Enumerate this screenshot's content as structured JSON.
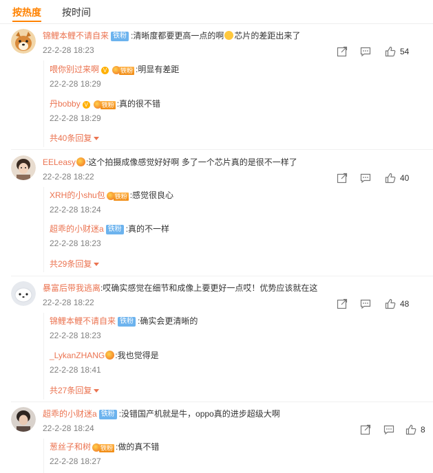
{
  "tabs": {
    "hot": "按热度",
    "time": "按时间"
  },
  "comments": [
    {
      "user": "锦鲤本鲤不请自来",
      "badge": "铁粉",
      "text": ":清晰度都要更高一点的啊",
      "text2": "芯片的差距出来了",
      "time": "22-2-28 18:23",
      "likes": "54",
      "replies": [
        {
          "user": "喂你别过来啊",
          "badge": "铁粉",
          "text": ":明显有差距",
          "time": "22-2-28 18:29"
        },
        {
          "user": "丹bobby",
          "badge": "铁粉",
          "text": ":真的很不错",
          "time": "22-2-28 18:29"
        }
      ],
      "more": "共40条回复"
    },
    {
      "user": "EELeasy",
      "text": ":这个拍摄成像感觉好好啊 多了一个芯片真的是很不一样了",
      "time": "22-2-28 18:22",
      "likes": "40",
      "replies": [
        {
          "user": "XRH的小shu包",
          "badge": "铁粉",
          "text": ":感觉很良心",
          "time": "22-2-28 18:24"
        },
        {
          "user": "超乖的小财迷a",
          "badge": "铁粉",
          "text": ":真的不一样",
          "time": "22-2-28 18:23"
        }
      ],
      "more": "共29条回复"
    },
    {
      "user": "暴富后带我逃离",
      "text": ":哎确实感觉在细节和成像上要更好一点哎！优势应该就在这",
      "time": "22-2-28 18:22",
      "likes": "48",
      "replies": [
        {
          "user": "锦鲤本鲤不请自来",
          "badge": "铁粉",
          "text": ":确实会更清晰的",
          "time": "22-2-28 18:23"
        },
        {
          "user": "_LykanZHANG",
          "text": ":我也觉得是",
          "time": "22-2-28 18:41"
        }
      ],
      "more": "共27条回复"
    },
    {
      "user": "超乖的小财迷a",
      "badge": "铁粉",
      "text": ":没错国产机就是牛，oppo真的进步超级大啊",
      "time": "22-2-28 18:24",
      "likes": "8",
      "replies": [
        {
          "user": "葱丝子和树",
          "badge": "铁粉",
          "text": ":做的真不错",
          "time": "22-2-28 18:27"
        }
      ]
    }
  ],
  "colors": {
    "accent": "#ff8200",
    "username": "#eb7350",
    "fan_badge": "#6cb3ee",
    "time": "#808080"
  },
  "icons": [
    "share-icon",
    "comment-icon",
    "like-icon",
    "vip-icon",
    "fan-heart-icon",
    "dropdown-triangle-icon"
  ]
}
